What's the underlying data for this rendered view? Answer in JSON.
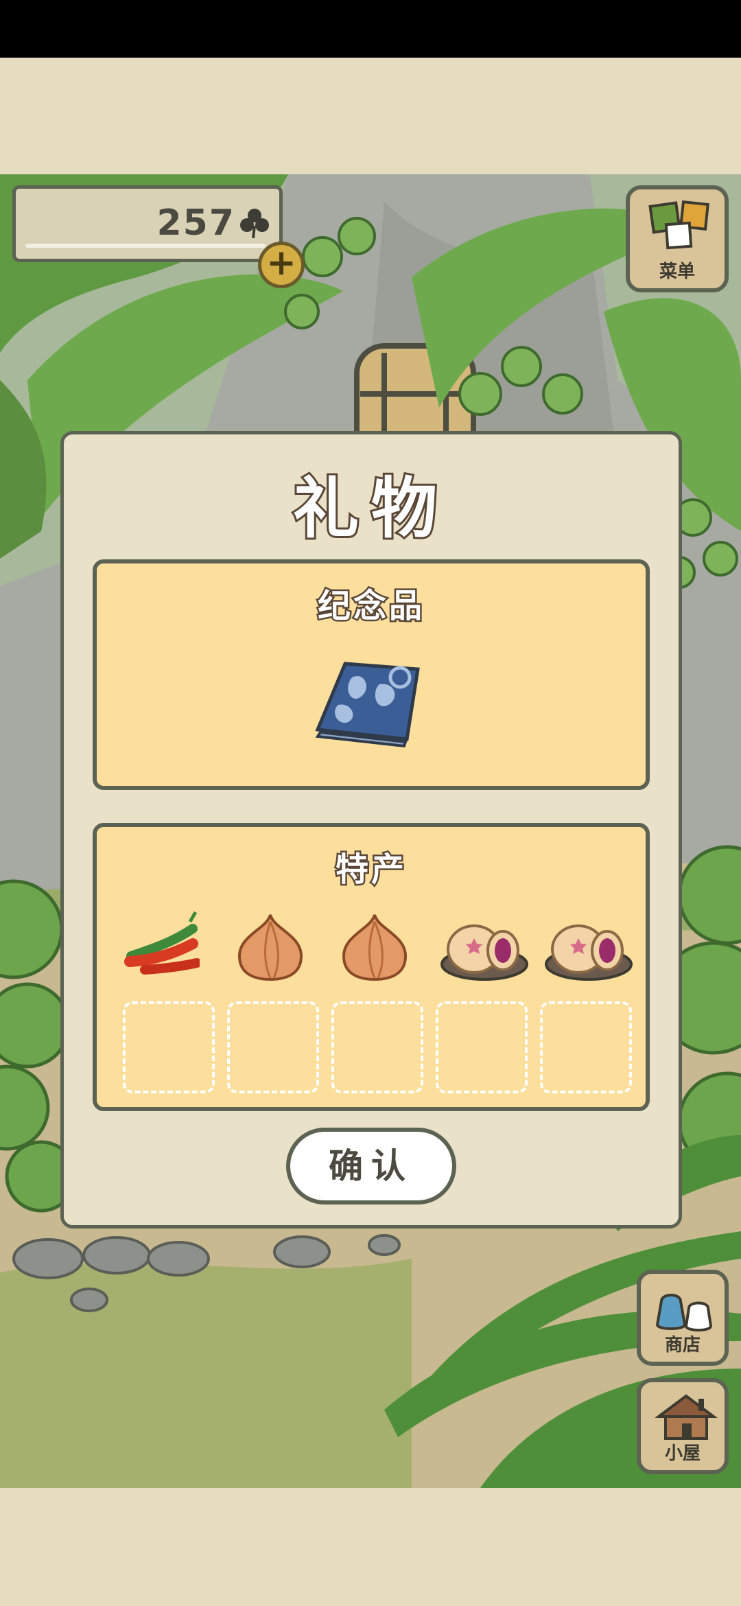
{
  "hud": {
    "clover_count": "257",
    "clover_icon": "clover-icon",
    "add_icon": "plus",
    "menu_label": "菜单",
    "shop_label": "商店",
    "house_label": "小屋"
  },
  "dialog": {
    "title": "礼物",
    "souvenir_title": "纪念品",
    "souvenir_item": "blue-patterned-handkerchief",
    "specialty_title": "特产",
    "specialty_items": [
      "chili-peppers",
      "onion",
      "onion",
      "taro-pastry",
      "taro-pastry"
    ],
    "empty_slots": 5,
    "confirm_label": "确认"
  },
  "colors": {
    "panel_fill": "#fcdf9d",
    "dialog_fill": "#e9e2c8",
    "outline": "#5c6352",
    "title_stroke": "#5a4636"
  }
}
